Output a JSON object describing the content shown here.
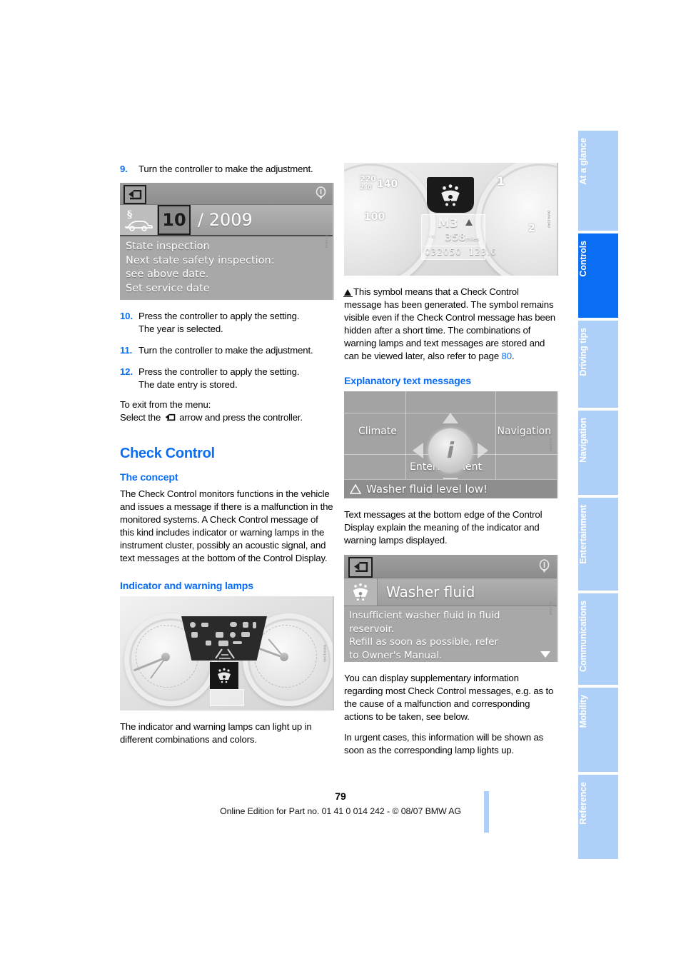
{
  "page": {
    "number": "79",
    "footer_line": "Online Edition for Part no. 01 41 0 014 242 - © 08/07 BMW AG"
  },
  "sidebar": {
    "tabs": [
      {
        "label": "At a glance",
        "active": false
      },
      {
        "label": "Controls",
        "active": true
      },
      {
        "label": "Driving tips",
        "active": false
      },
      {
        "label": "Navigation",
        "active": false
      },
      {
        "label": "Entertainment",
        "active": false
      },
      {
        "label": "Communications",
        "active": false
      },
      {
        "label": "Mobility",
        "active": false
      },
      {
        "label": "Reference",
        "active": false
      }
    ],
    "active_color": "#0a6ef5",
    "inactive_color": "#aed0f8"
  },
  "left_column": {
    "step9": {
      "num": "9.",
      "text": "Turn the controller to make the adjustment."
    },
    "fig_service_date": {
      "month": "10",
      "year": "/ 2009",
      "lines": [
        "State inspection",
        "Next state safety inspection:",
        "see above date.",
        "Set service date"
      ],
      "back_icon": "back-arrow-icon",
      "info_icon": "info-icon",
      "service_icon": "service-vehicle-icon"
    },
    "step10": {
      "num": "10.",
      "line1": "Press the controller to apply the setting.",
      "line2": "The year is selected."
    },
    "step11": {
      "num": "11.",
      "line1": "Turn the controller to make the adjustment.",
      "line2": ""
    },
    "step12": {
      "num": "12.",
      "line1": "Press the controller to apply the setting.",
      "line2": "The date entry is stored."
    },
    "exit_line1": "To exit from the menu:",
    "exit_before": "Select the",
    "exit_after": "arrow and press the controller.",
    "heading": "Check Control",
    "concept_heading": "The concept",
    "concept_body": "The Check Control monitors functions in the vehicle and issues a message if there is a malfunction in the monitored systems. A Check Control message of this kind includes indicator or warning lamps in the instrument cluster, possibly an acoustic signal, and text messages at the bottom of the Control Display.",
    "lamps_heading": "Indicator and warning lamps",
    "lamps_body": "The indicator and warning lamps can light up in different combinations and colors."
  },
  "right_column": {
    "fig_cluster": {
      "gear": "M3",
      "range": "358",
      "range_unit": "miles",
      "odometer": "032050",
      "trip": "123.6",
      "speed_ticks": [
        "220",
        "240",
        "140",
        "100"
      ],
      "tach_ticks": [
        "1",
        "2"
      ],
      "warning_symbol": "washer-fluid-icon"
    },
    "symbol_note": "This symbol means that a Check Control message has been generated. The symbol remains visible even if the Check Control message has been hidden after a short time. The combinations of warning lamps and text messages are stored and can be viewed later, also refer to page",
    "symbol_note_pageref": "80",
    "explanatory_heading": "Explanatory text messages",
    "fig_menu": {
      "climate": "Climate",
      "navigation": "Navigation",
      "entertainment": "Entertainment",
      "center_icon": "info-idrive-icon",
      "message": "Washer fluid level low!"
    },
    "explanatory_body": "Text messages at the bottom edge of the Control Display explain the meaning of the indicator and warning lamps displayed.",
    "fig_detail": {
      "title": "Washer fluid",
      "lines": [
        "Insufficient washer fluid in fluid",
        "reservoir.",
        "Refill as soon as possible, refer",
        "to Owner's Manual."
      ],
      "back_icon": "back-arrow-icon",
      "info_icon": "info-icon",
      "washer_icon": "washer-fluid-icon",
      "scroll_icon": "scroll-down-icon"
    },
    "supplementary_body": "You can display supplementary information regarding most Check Control messages, e.g. as to the cause of a malfunction and corresponding actions to be taken, see below.",
    "urgent_body": "In urgent cases, this information will be shown as soon as the corresponding lamp lights up."
  }
}
